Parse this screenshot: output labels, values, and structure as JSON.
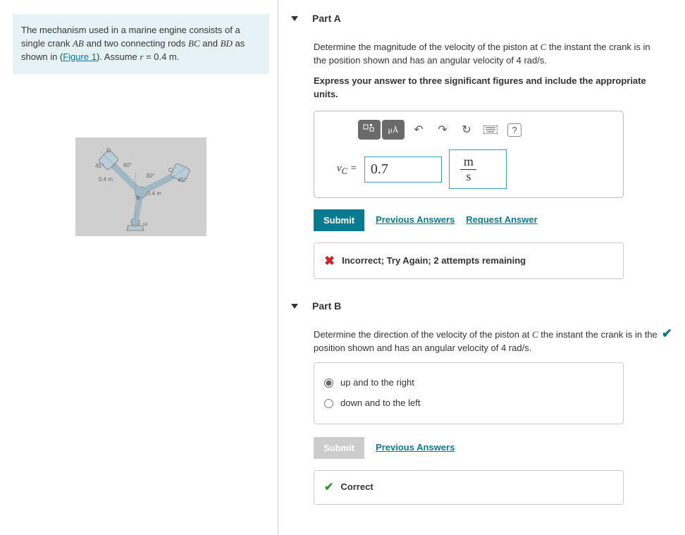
{
  "problem": {
    "text_parts": {
      "p1": "The mechanism used in a marine engine consists of a single crank ",
      "ab": "AB",
      "p2": " and two connecting rods ",
      "bc": "BC",
      "p3": " and ",
      "bd": "BD",
      "p4": " as shown in (",
      "figlink": "Figure 1",
      "p5": "). Assume ",
      "rvar": "r",
      "p6": " = 0.4 m."
    }
  },
  "figure": {
    "labels": {
      "d": "D",
      "c": "C",
      "b": "B",
      "a45l": "45°",
      "a60": "60°",
      "a30": "30°",
      "a45r": "45°",
      "len1": "0.4 m",
      "len2": "0.4 m",
      "omega": "ω"
    }
  },
  "partA": {
    "title": "Part A",
    "desc": "Determine the magnitude of the velocity of the piston at ",
    "cvar": "C",
    "desc2": " the instant the crank is in the position shown and has an angular velocity of 4 rad/s.",
    "instruction": "Express your answer to three significant figures and include the appropriate units.",
    "vcLabel": "v",
    "vcSub": "C",
    "equals": " = ",
    "value": "0.7",
    "unitNum": "m",
    "unitDen": "s",
    "toolbar": {
      "units": "μÅ",
      "help": "?"
    },
    "submitLabel": "Submit",
    "prevAnswers": "Previous Answers",
    "requestAnswer": "Request Answer",
    "feedback": "Incorrect; Try Again; 2 attempts remaining"
  },
  "partB": {
    "title": "Part B",
    "desc": "Determine the direction of the velocity of the piston at ",
    "cvar": "C",
    "desc2": " the instant the crank is in the position shown and has an angular velocity of 4 rad/s.",
    "opt1": "up and to the right",
    "opt2": "down and to the left",
    "submitLabel": "Submit",
    "prevAnswers": "Previous Answers",
    "feedback": "Correct"
  }
}
